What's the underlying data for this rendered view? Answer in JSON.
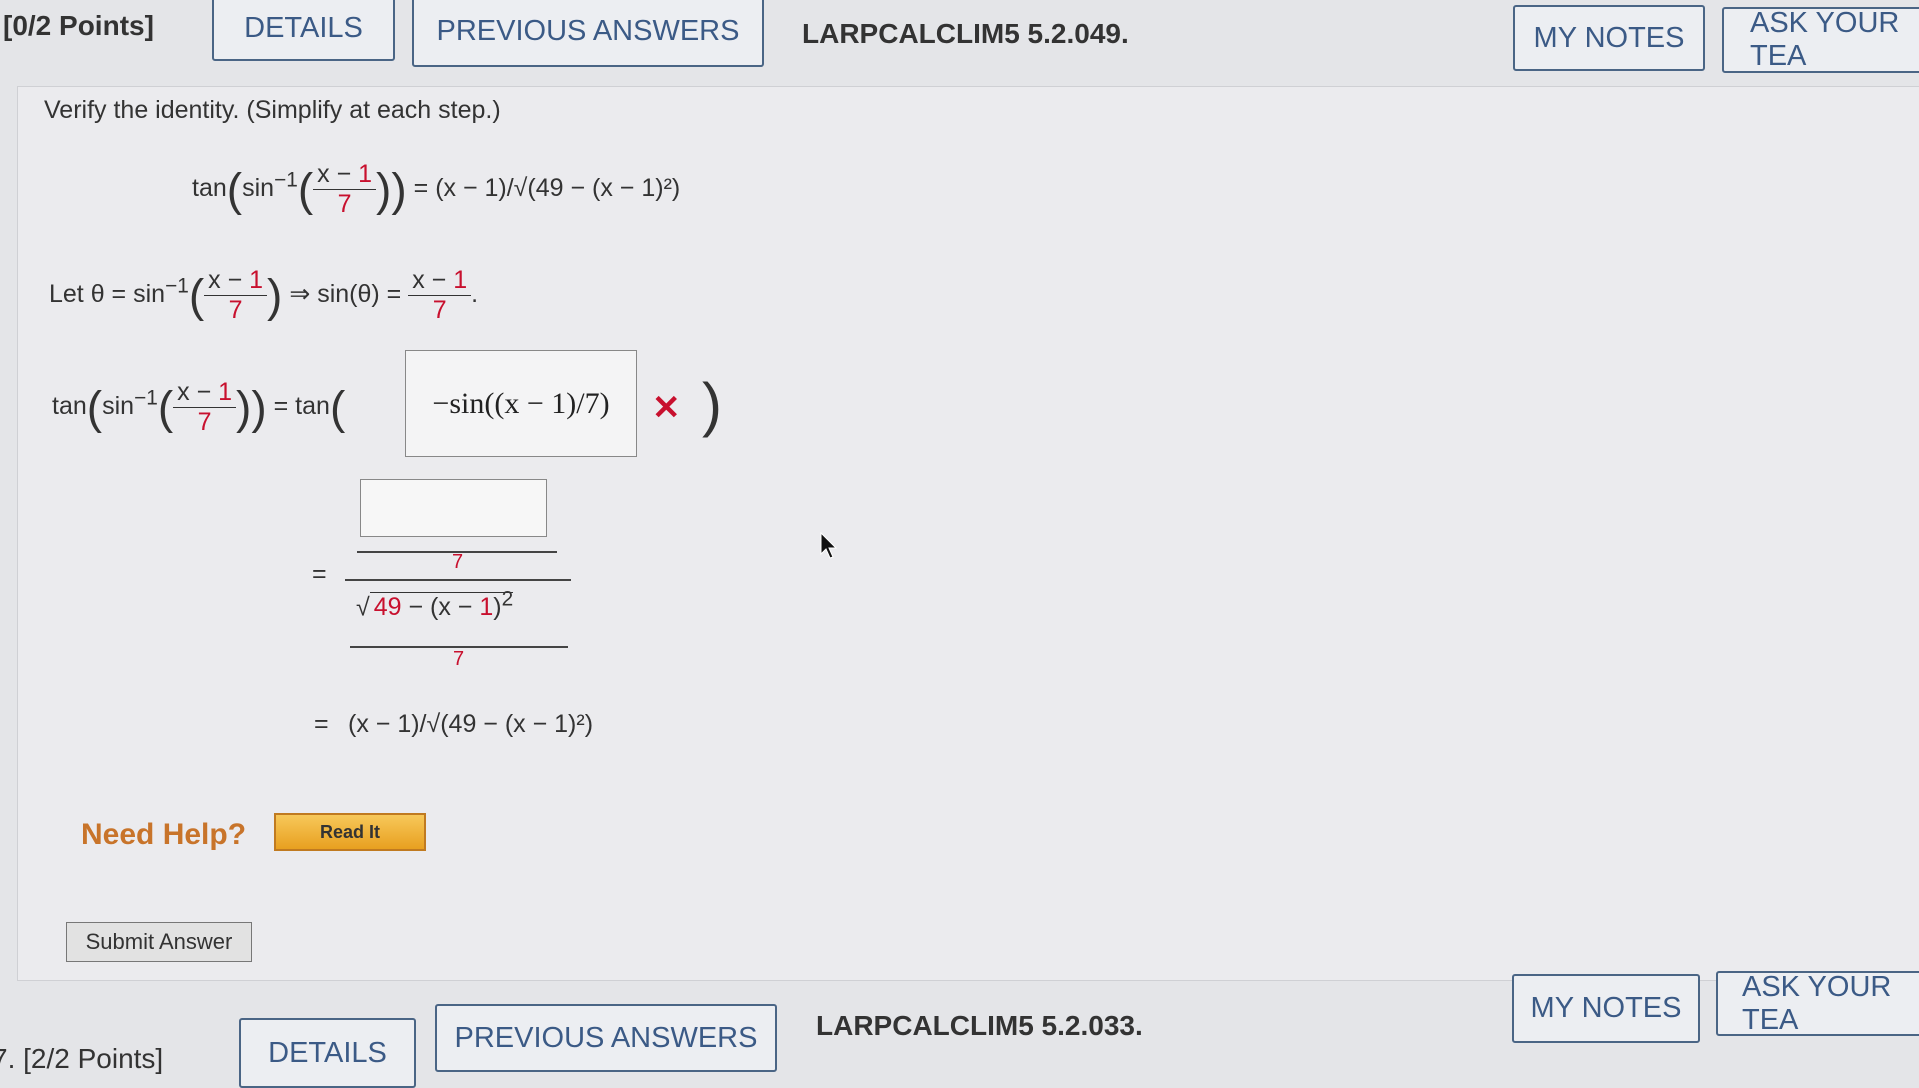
{
  "top_question": {
    "points": "[0/2 Points]",
    "details_label": "DETAILS",
    "previous_answers_label": "PREVIOUS ANSWERS",
    "code": "LARPCALCLIM5 5.2.049.",
    "my_notes_label": "MY NOTES",
    "ask_label": "ASK YOUR TEA"
  },
  "content": {
    "instruction": "Verify the identity. (Simplify at each step.)",
    "identity": {
      "lhs": "tan(sin⁻¹((x − 1)/7))",
      "rhs": "(x − 1)/√(49 − (x − 1)²)"
    },
    "let_line": "Let θ = sin⁻¹((x − 1)/7) ⇒ sin(θ) = (x − 1)/7.",
    "step1_answer": "−sin((x − 1)/7)",
    "step1_status": "incorrect",
    "step2_input_value": "",
    "result": "(x − 1)/√(49 − (x − 1)²)"
  },
  "help": {
    "need_help": "Need Help?",
    "read_it": "Read It"
  },
  "submit_label": "Submit Answer",
  "next_question": {
    "points": "7. [2/2 Points]",
    "details_label": "DETAILS",
    "previous_answers_label": "PREVIOUS ANSWERS",
    "code": "LARPCALCLIM5 5.2.033.",
    "my_notes_label": "MY NOTES",
    "ask_label": "ASK YOUR TEA"
  },
  "colors": {
    "accent": "#3b5a86",
    "error": "#c8102e",
    "help": "#c8742a",
    "read_it": "#f0b030"
  }
}
